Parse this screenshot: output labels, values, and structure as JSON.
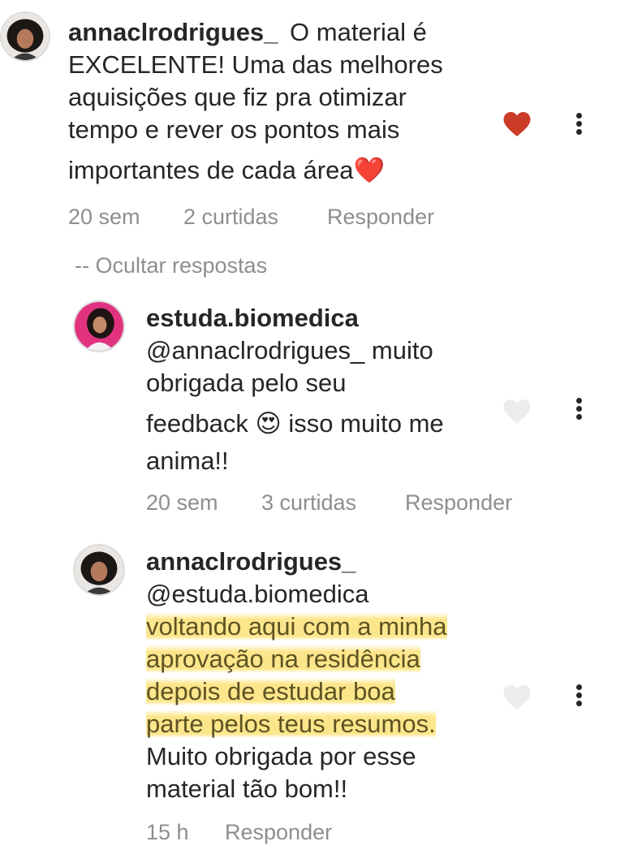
{
  "comments": [
    {
      "username": "annaclrodrigues_",
      "text_lines": [
        "O material é",
        "EXCELENTE! Uma das melhores",
        "aquisições que fiz pra otimizar",
        "tempo e rever os pontos mais",
        "importantes de cada área"
      ],
      "emoji_end": "❤️",
      "time": "20 sem",
      "likes": "2 curtidas",
      "reply_label": "Responder",
      "liked": true
    }
  ],
  "hide_replies_label": "-- Ocultar respostas",
  "replies": [
    {
      "username": "estuda.biomedica",
      "text_lines": [
        "@annaclrodrigues_ muito",
        "obrigada pelo seu",
        "feedback",
        "isso muito me",
        "anima!!"
      ],
      "emoji_inline": "😍",
      "time": "20 sem",
      "likes": "3 curtidas",
      "reply_label": "Responder",
      "liked": false
    },
    {
      "username": "annaclrodrigues_",
      "text_lines": [
        "@estuda.biomedica",
        "voltando aqui com a minha",
        "aprovação na residência",
        "depois de estudar boa",
        "parte pelos teus resumos.",
        "Muito obrigada por esse",
        "material tão bom!!"
      ],
      "time": "15 h",
      "reply_label": "Responder",
      "liked": false
    }
  ],
  "colors": {
    "text": "#262626",
    "muted": "#8e8e8e",
    "like_active": "#ed4956",
    "highlight": "#fce278"
  },
  "icons": [
    "heart-icon",
    "more-options-icon"
  ]
}
